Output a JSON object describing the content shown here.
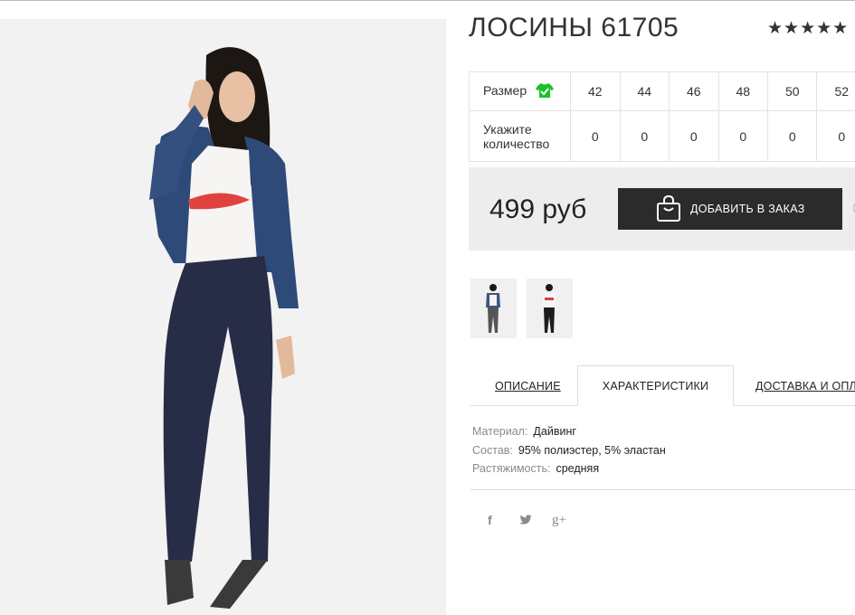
{
  "product": {
    "title": "ЛОСИНЫ 61705",
    "rating_stars": "★★★★★",
    "price": "499 руб"
  },
  "size_table": {
    "size_label": "Размер",
    "qty_label_line1": "Укажите",
    "qty_label_line2": "количество",
    "sizes": [
      "42",
      "44",
      "46",
      "48",
      "50",
      "52"
    ],
    "quantities": [
      "0",
      "0",
      "0",
      "0",
      "0",
      "0"
    ],
    "icon": "tshirt-check-icon",
    "icon_color": "#19c02b"
  },
  "cart": {
    "add_button_label": "ДОБАВИТЬ В ЗАКАЗ",
    "button_color": "#2b2b2b"
  },
  "tabs": [
    {
      "label": "ОПИСАНИЕ",
      "active": false
    },
    {
      "label": "ХАРАКТЕРИСТИКИ",
      "active": true
    },
    {
      "label": "ДОСТАВКА И ОПЛА",
      "active": false
    }
  ],
  "specs": [
    {
      "key": "Материал:",
      "value": "Дайвинг"
    },
    {
      "key": "Состав:",
      "value": "95% полиэстер, 5% эластан"
    },
    {
      "key": "Растяжимость:",
      "value": "средняя"
    }
  ],
  "social": {
    "facebook": "f",
    "twitter": "twitter-icon",
    "google_plus": "g+"
  }
}
